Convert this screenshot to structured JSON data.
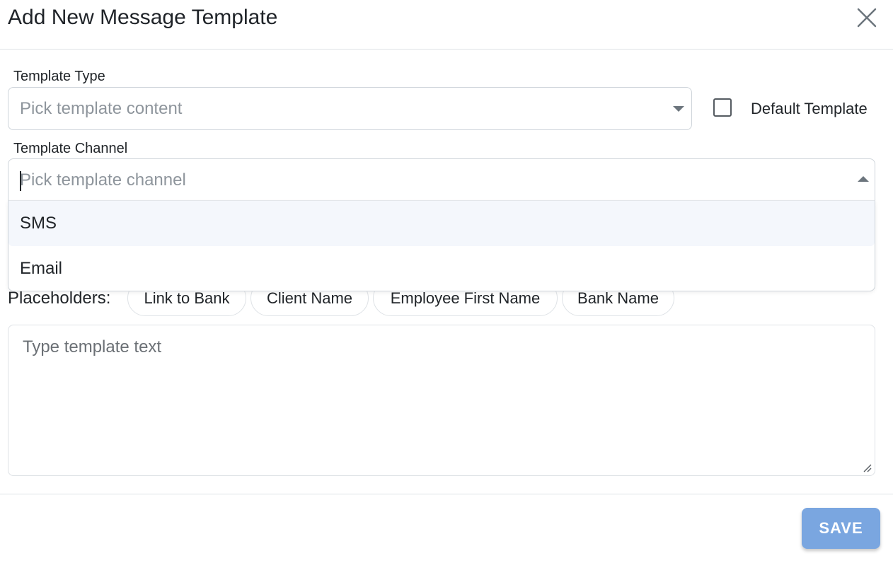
{
  "modal": {
    "title": "Add New Message Template",
    "close_icon": "close-icon"
  },
  "template_type": {
    "label": "Template Type",
    "placeholder": "Pick template content",
    "caret_icon": "chevron-down-icon"
  },
  "default_template": {
    "label": "Default Template",
    "checked": false
  },
  "template_channel": {
    "label": "Template Channel",
    "placeholder": "Pick template channel",
    "caret_icon": "chevron-up-icon",
    "expanded": true,
    "options": [
      "SMS",
      "Email"
    ],
    "highlighted_option": "SMS"
  },
  "placeholders": {
    "label": "Placeholders:",
    "chips": [
      "Link to Bank",
      "Client Name",
      "Employee First Name",
      "Bank Name"
    ]
  },
  "template_text": {
    "placeholder": "Type template text"
  },
  "footer": {
    "save_label": "SAVE"
  },
  "colors": {
    "save_button_bg": "#7aa6e0",
    "highlight_option_bg": "#f4f7fc",
    "placeholder_text": "#8e959c",
    "border": "#ced4da"
  }
}
